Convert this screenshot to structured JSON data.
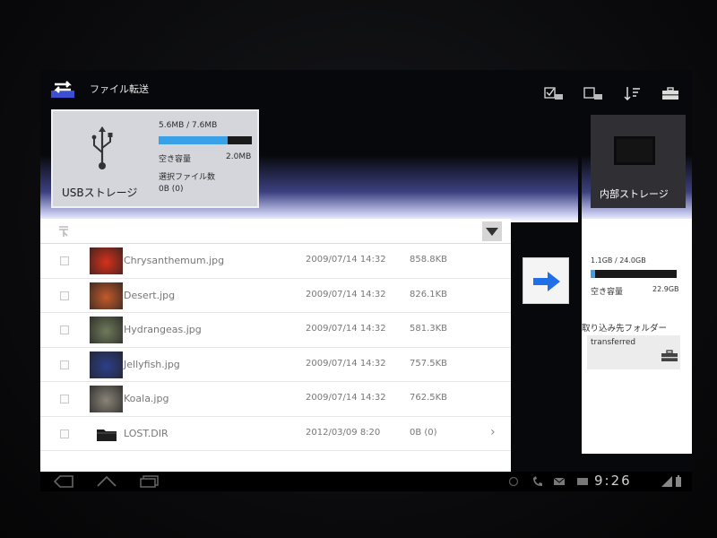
{
  "app": {
    "title": "ファイル転送"
  },
  "actions": [
    {
      "name": "select-all-icon",
      "label": ""
    },
    {
      "name": "deselect-all-icon",
      "label": ""
    },
    {
      "name": "sort-icon",
      "label": ""
    },
    {
      "name": "toolbox-icon",
      "label": ""
    }
  ],
  "usb": {
    "label": "USBストレージ",
    "used": "5.6MB / 7.6MB",
    "used_fraction": 0.74,
    "free_label": "空き容量",
    "free_value": "2.0MB",
    "selected_label": "選択ファイル数",
    "selected_value": "0B (0)"
  },
  "files": [
    {
      "name": "Chrysanthemum.jpg",
      "date": "2009/07/14 14:32",
      "size": "858.8KB",
      "type": "image",
      "thumb_color": "#d8301a"
    },
    {
      "name": "Desert.jpg",
      "date": "2009/07/14 14:32",
      "size": "826.1KB",
      "type": "image",
      "thumb_color": "#c25a2a"
    },
    {
      "name": "Hydrangeas.jpg",
      "date": "2009/07/14 14:32",
      "size": "581.3KB",
      "type": "image",
      "thumb_color": "#6f7a5a"
    },
    {
      "name": "Jellyfish.jpg",
      "date": "2009/07/14 14:32",
      "size": "757.5KB",
      "type": "image",
      "thumb_color": "#2d3f8a"
    },
    {
      "name": "Koala.jpg",
      "date": "2009/07/14 14:32",
      "size": "762.5KB",
      "type": "image",
      "thumb_color": "#8a8478"
    },
    {
      "name": "LOST.DIR",
      "date": "2012/03/09 8:20",
      "size": "0B (0)",
      "type": "folder",
      "thumb_color": "#222222"
    }
  ],
  "internal": {
    "label": "内部ストレージ",
    "used": "1.1GB / 24.0GB",
    "used_fraction": 0.05,
    "free_label": "空き容量",
    "free_value": "22.9GB",
    "dest_label": "取り込み先フォルダー",
    "dest_folder": "transferred"
  },
  "system": {
    "clock": "9:26"
  },
  "colors": {
    "accent": "#3aa0e8",
    "arrow": "#1f6fe8"
  }
}
